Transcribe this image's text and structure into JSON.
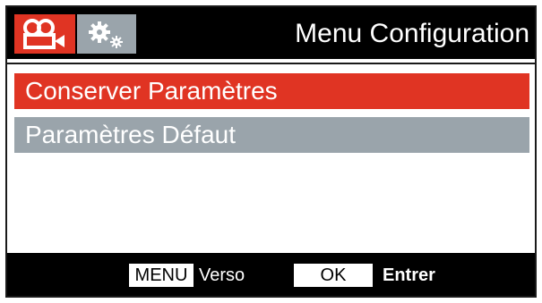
{
  "header": {
    "title": "Menu Configuration",
    "tabs": [
      {
        "icon": "video-camera-icon",
        "active": true
      },
      {
        "icon": "gears-icon",
        "active": false
      }
    ]
  },
  "menu": {
    "items": [
      {
        "label": "Conserver Paramètres",
        "selected": true
      },
      {
        "label": "Paramètres Défaut",
        "selected": false
      }
    ]
  },
  "footer": {
    "menu_key": "MENU",
    "menu_hint": "Verso",
    "ok_key": "OK",
    "ok_hint": "Entrer"
  },
  "colors": {
    "accent": "#e03423",
    "inactive": "#9aa4ab",
    "bar": "#000000"
  }
}
